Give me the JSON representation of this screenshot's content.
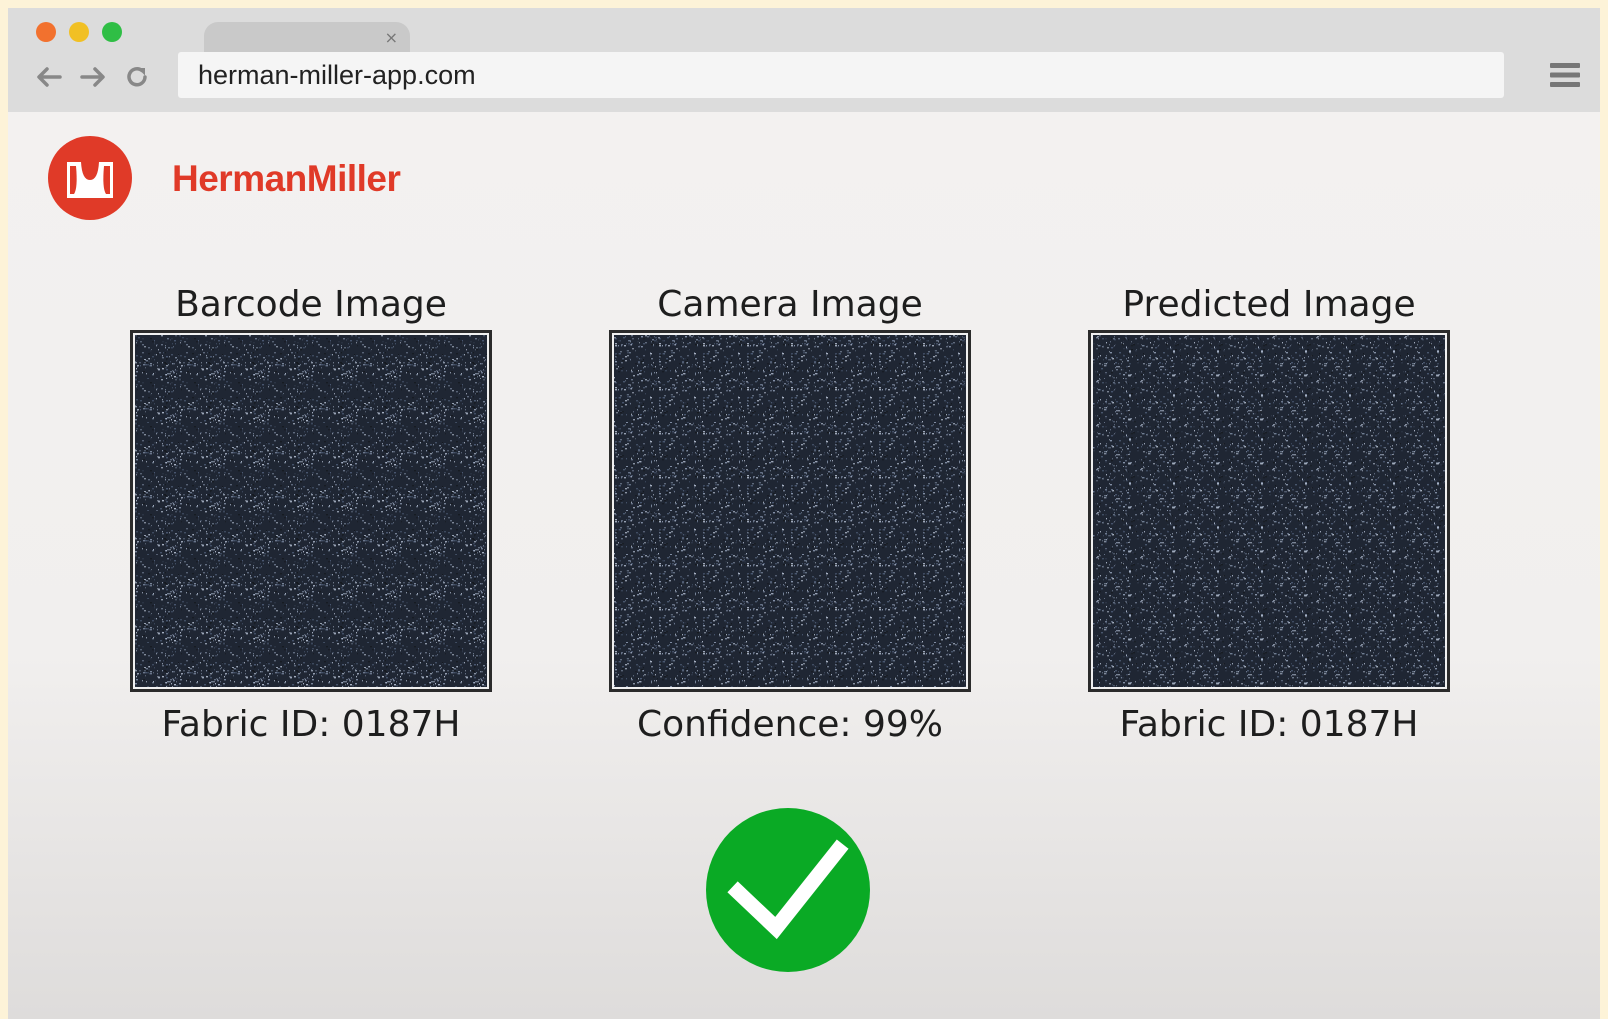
{
  "browser": {
    "url": "herman-miller-app.com",
    "tab_close": "×",
    "traffic_colors": [
      "#f2712e",
      "#f1c024",
      "#2fbe45"
    ]
  },
  "brand": {
    "name": "HermanMiller",
    "color": "#e03a28"
  },
  "panels": [
    {
      "title": "Barcode Image",
      "caption": "Fabric ID: 0187H"
    },
    {
      "title": "Camera Image",
      "caption": "Confidence: 99%"
    },
    {
      "title": "Predicted Image",
      "caption": "Fabric ID: 0187H"
    }
  ],
  "status": {
    "icon": "check-circle-icon",
    "color": "#0aaa25"
  },
  "fabric_color": "#1f2633"
}
